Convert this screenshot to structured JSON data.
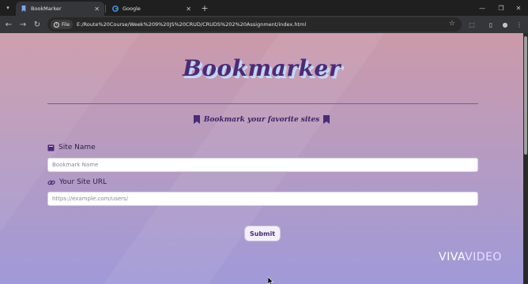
{
  "browser": {
    "tabs": [
      {
        "label": "BookMarker",
        "active": true,
        "icon": "bookmark-favicon"
      },
      {
        "label": "Google",
        "active": false,
        "icon": "google-favicon"
      }
    ],
    "new_tab_glyph": "+",
    "address_bar": {
      "chip_label": "File",
      "url": "E:/Route%20Course/Week%209%20JS%20CRUD/CRUDS%202%20Assignment/index.html"
    }
  },
  "page": {
    "brand": "Bookmarker",
    "tagline": "Bookmark your favorite sites",
    "site_name": {
      "label": "Site Name",
      "placeholder": "Bookmark Name",
      "value": ""
    },
    "site_url": {
      "label": "Your Site URL",
      "placeholder": "https://example.com/users/",
      "value": ""
    },
    "submit_label": "Submit"
  },
  "watermark": {
    "left": "VIVA",
    "right": "VIDEO"
  },
  "colors": {
    "brand": "#4b2a78",
    "divider": "#7a58a8",
    "bg_top": "#cc9aa9",
    "bg_bottom": "#a09ad8"
  }
}
